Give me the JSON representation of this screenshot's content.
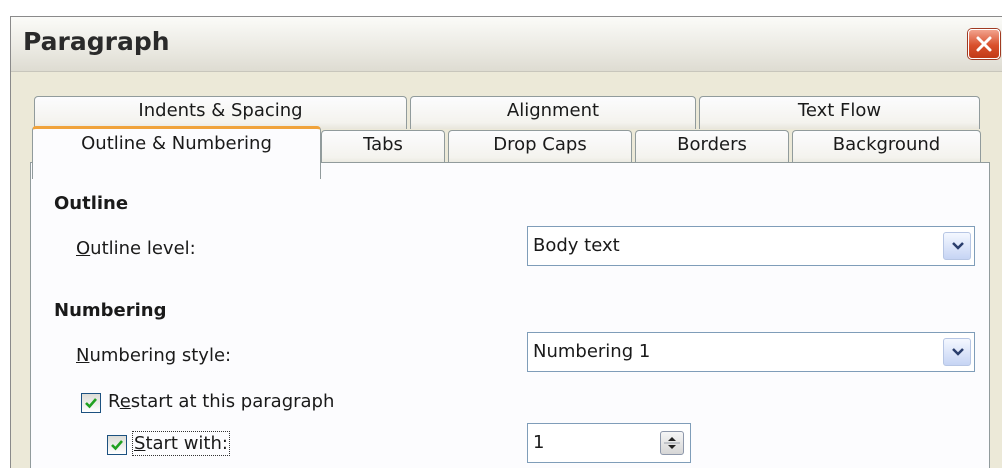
{
  "dialog": {
    "title": "Paragraph"
  },
  "tabs": {
    "row1": [
      "Indents & Spacing",
      "Alignment",
      "Text Flow"
    ],
    "row2": [
      "Outline & Numbering",
      "Tabs",
      "Drop Caps",
      "Borders",
      "Background"
    ],
    "active": "Outline & Numbering"
  },
  "outline": {
    "heading": "Outline",
    "level_label_first": "O",
    "level_label_rest": "utline level:",
    "level_value": "Body text"
  },
  "numbering": {
    "heading": "Numbering",
    "style_label_first": "N",
    "style_label_rest": "umbering style:",
    "style_value": "Numbering 1",
    "restart_label_first": "R",
    "restart_label_mid": "e",
    "restart_label_rest": "start at this paragraph",
    "restart_checked": true,
    "start_with_label_first": "S",
    "start_with_label_rest": "tart with:",
    "start_with_checked": true,
    "start_with_value": "1"
  },
  "colors": {
    "tab_active_accent": "#f0a33b",
    "close_button": "#d9502c",
    "check_mark": "#21a121"
  },
  "icons": [
    "close-icon",
    "chevron-down-icon",
    "spin-arrows-icon",
    "check-icon"
  ]
}
